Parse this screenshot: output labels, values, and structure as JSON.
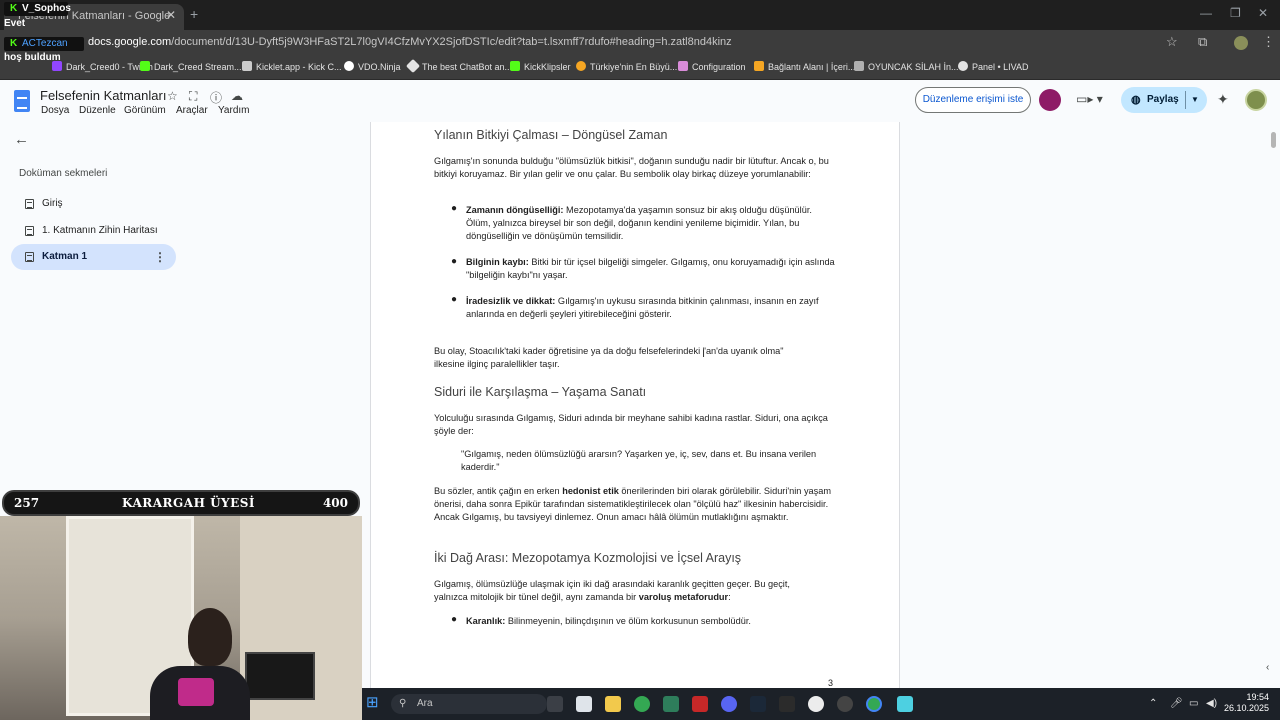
{
  "browser": {
    "tab_title": "Felsefenin Katmanları - Google",
    "url_host": "docs.google.com",
    "url_path": "/document/d/13U-Dyft5j9W3HFaST2L7l0gVI4CfzMvYX2SjofDSTIc/edit?tab=t.lsxmff7rdufo#heading=h.zatl8nd4kinz",
    "bookmarks": [
      "Dark_Creed0 - Twitch",
      "Dark_Creed Stream...",
      "Kicklet.app - Kick C...",
      "VDO.Ninja",
      "The best ChatBot an...",
      "KickKlipsler",
      "Türkiye'nin En Büyü...",
      "Configuration",
      "Bağlantı Alanı | İçeri...",
      "OYUNCAK SİLAH İn...",
      "Panel • LIVAD"
    ]
  },
  "overlay": {
    "user1": "V_Sophos",
    "msg1": "Evet",
    "user2": "ACTezcan",
    "msg2": "hoş buldum"
  },
  "docs": {
    "title": "Felsefenin Katmanları",
    "menu": [
      "Dosya",
      "Düzenle",
      "Görünüm",
      "Araçlar",
      "Yardım"
    ],
    "edit_access_label": "Düzenleme erişimi iste",
    "share_label": "Paylaş"
  },
  "sidebar": {
    "title": "Doküman sekmeleri",
    "items": [
      {
        "label": "Giriş"
      },
      {
        "label": "1. Katmanın Zihin Haritası"
      },
      {
        "label": "Katman 1"
      }
    ]
  },
  "content": {
    "h1": "Yılanın Bitkiyi Çalması – Döngüsel Zaman",
    "p1": "Gılgamış'ın sonunda bulduğu \"ölümsüzlük bitkisi\", doğanın sunduğu nadir bir lütuftur. Ancak o, bu bitkiyi koruyamaz. Bir yılan gelir ve onu çalar. Bu sembolik olay birkaç düzeye yorumlanabilir:",
    "b1_bold": "Zamanın döngüselliği:",
    "b1_text": " Mezopotamya'da yaşamın sonsuz bir akış olduğu düşünülür. Ölüm, yalnızca bireysel bir son değil, doğanın kendini yenileme biçimidir. Yılan, bu döngüselliğin ve dönüşümün temsilidir.",
    "b2_bold": "Bilginin kaybı:",
    "b2_text": " Bitki bir tür içsel bilgeliği simgeler. Gılgamış, onu koruyamadığı için aslında \"bilgeliğin kaybı\"nı yaşar.",
    "b3_bold": "İradesizlik ve dikkat:",
    "b3_text": " Gılgamış'ın uykusu sırasında bitkinin çalınması, insanın en zayıf anlarında en değerli şeyleri yitirebileceğini gösterir.",
    "p2": "Bu olay, Stoacılık'taki kader öğretisine ya da doğu felsefelerindeki \"an'da uyanık olma\" ilkesine ilginç paralellikler taşır.",
    "h2": "Siduri ile Karşılaşma – Yaşama Sanatı",
    "p3": "Yolculuğu sırasında Gılgamış, Siduri adında bir meyhane sahibi kadına rastlar. Siduri, ona açıkça şöyle der:",
    "quote": "\"Gılgamış, neden ölümsüzlüğü ararsın? Yaşarken ye, iç, sev, dans et. Bu insana verilen kaderdir.\"",
    "p4_a": "Bu sözler, antik çağın en erken ",
    "p4_bold": "hedonist etik",
    "p4_b": " önerilerinden biri olarak görülebilir. Siduri'nin yaşam önerisi, daha sonra Epikür tarafından sistematikleştirilecek olan \"ölçülü haz\" ilkesinin habercisidir. Ancak Gılgamış, bu tavsiyeyi dinlemez. Onun amacı hâlâ ölümün mutlaklığını aşmaktır.",
    "h3": "İki Dağ Arası: Mezopotamya Kozmolojisi ve İçsel Arayış",
    "p5_a": "Gılgamış, ölümsüzlüğe ulaşmak için iki dağ arasındaki karanlık geçitten geçer. Bu geçit, yalnızca mitolojik bir tünel değil, aynı zamanda bir ",
    "p5_bold": "varoluş metaforudur",
    "p5_b": ":",
    "b4_bold": "Karanlık:",
    "b4_text": " Bilinmeyenin, bilinçdışının ve ölüm korkusunun sembolüdür.",
    "page_number": "3"
  },
  "cam": {
    "left_num": "257",
    "label": "KARARGAH ÜYESİ",
    "right_num": "400"
  },
  "taskbar": {
    "search_placeholder": "Ara",
    "time": "19:54",
    "date": "26.10.2025"
  }
}
